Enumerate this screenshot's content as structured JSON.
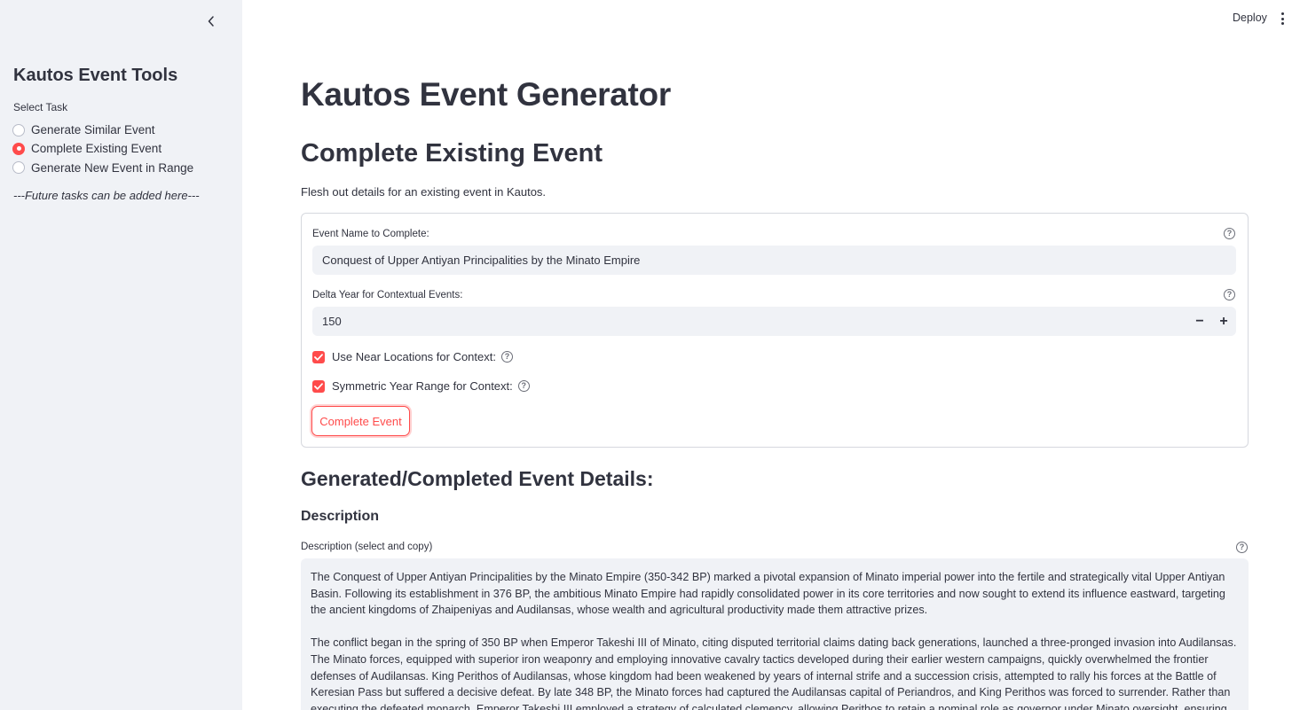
{
  "sidebar": {
    "title": "Kautos Event Tools",
    "select_label": "Select Task",
    "options": [
      {
        "label": "Generate Similar Event",
        "selected": false
      },
      {
        "label": "Complete Existing Event",
        "selected": true
      },
      {
        "label": "Generate New Event in Range",
        "selected": false
      }
    ],
    "future_note": "---Future tasks can be added here---"
  },
  "header": {
    "deploy_label": "Deploy"
  },
  "main": {
    "title": "Kautos Event Generator",
    "section_title": "Complete Existing Event",
    "section_description": "Flesh out details for an existing event in Kautos.",
    "form": {
      "event_name_label": "Event Name to Complete:",
      "event_name_value": "Conquest of Upper Antiyan Principalities by the Minato Empire",
      "delta_year_label": "Delta Year for Contextual Events:",
      "delta_year_value": "150",
      "stepper_minus": "−",
      "stepper_plus": "+",
      "near_locations_label": "Use Near Locations for Context:",
      "near_locations_checked": true,
      "symmetric_range_label": "Symmetric Year Range for Context:",
      "symmetric_range_checked": true,
      "submit_label": "Complete Event"
    },
    "results": {
      "title": "Generated/Completed Event Details:",
      "description_heading": "Description",
      "description_field_label": "Description (select and copy)",
      "description_paragraphs": [
        "The Conquest of Upper Antiyan Principalities by the Minato Empire (350-342 BP) marked a pivotal expansion of Minato imperial power into the fertile and strategically vital Upper Antiyan Basin. Following its establishment in 376 BP, the ambitious Minato Empire had rapidly consolidated power in its core territories and now sought to extend its influence eastward, targeting the ancient kingdoms of Zhaipeniyas and Audilansas, whose wealth and agricultural productivity made them attractive prizes.",
        "The conflict began in the spring of 350 BP when Emperor Takeshi III of Minato, citing disputed territorial claims dating back generations, launched a three-pronged invasion into Audilansas. The Minato forces, equipped with superior iron weaponry and employing innovative cavalry tactics developed during their earlier western campaigns, quickly overwhelmed the frontier defenses of Audilansas. King Perithos of Audilansas, whose kingdom had been weakened by years of internal strife and a succession crisis, attempted to rally his forces at the Battle of Keresian Pass but suffered a decisive defeat. By late 348 BP, the Minato forces had captured the Audilansas capital of Periandros, and King Perithos was forced to surrender. Rather than executing the defeated monarch, Emperor Takeshi III employed a strategy of calculated clemency, allowing Perithos to retain a nominal role as governor under Minato oversight, ensuring the territory's stability."
      ]
    }
  }
}
